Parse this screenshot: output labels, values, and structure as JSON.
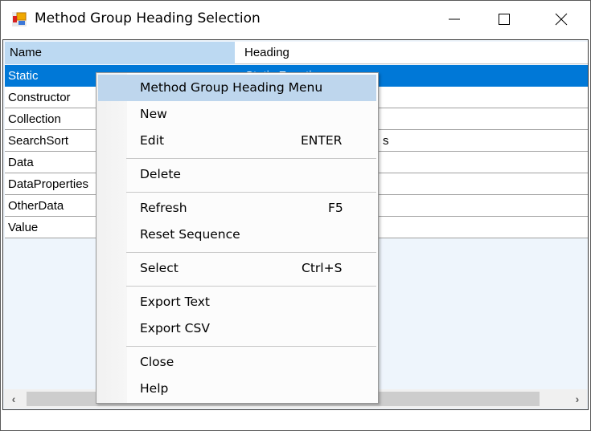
{
  "window": {
    "title": "Method Group Heading Selection",
    "controls": {
      "minimize": "minimize",
      "maximize": "maximize",
      "close": "close"
    }
  },
  "grid": {
    "columns": [
      "Name",
      "Heading"
    ],
    "rows": [
      {
        "name": "Static",
        "heading": "Static Functions",
        "selected": true
      },
      {
        "name": "Constructor",
        "heading": ""
      },
      {
        "name": "Collection",
        "heading": ""
      },
      {
        "name": "SearchSort",
        "heading": "s"
      },
      {
        "name": "Data",
        "heading": ""
      },
      {
        "name": "DataProperties",
        "heading": ""
      },
      {
        "name": "OtherData",
        "heading": ""
      },
      {
        "name": "Value",
        "heading": ""
      }
    ],
    "colors": {
      "selection": "#0078d7",
      "header_selected": "#bcd9f2",
      "empty_area": "#eef5fc"
    }
  },
  "context_menu": {
    "title": "Method Group Heading Menu",
    "items": [
      {
        "label": "New",
        "shortcut": ""
      },
      {
        "label": "Edit",
        "shortcut": "ENTER"
      },
      {
        "label": "Delete",
        "shortcut": ""
      },
      {
        "label": "Refresh",
        "shortcut": "F5"
      },
      {
        "label": "Reset Sequence",
        "shortcut": ""
      },
      {
        "label": "Select",
        "shortcut": "Ctrl+S"
      },
      {
        "label": "Export Text",
        "shortcut": ""
      },
      {
        "label": "Export CSV",
        "shortcut": ""
      },
      {
        "label": "Close",
        "shortcut": ""
      },
      {
        "label": "Help",
        "shortcut": ""
      }
    ],
    "highlight_color": "#bed6ed"
  },
  "scrollbar": {
    "left_arrow": "‹",
    "right_arrow": "›"
  }
}
